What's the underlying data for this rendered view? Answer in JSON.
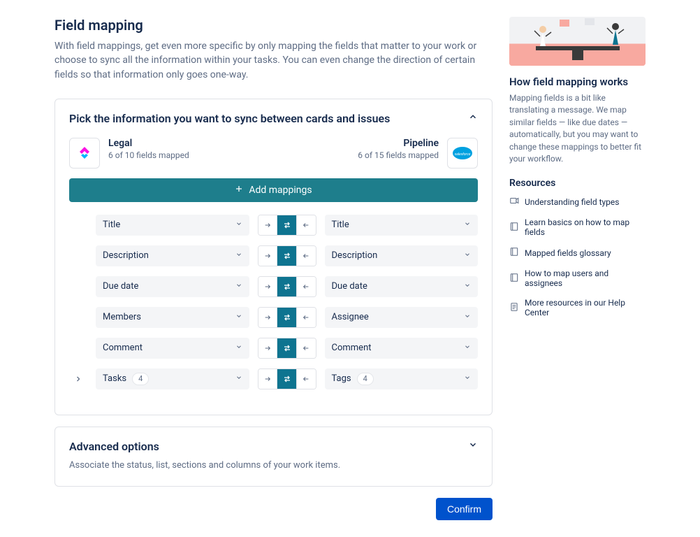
{
  "header": {
    "title": "Field mapping",
    "subtitle": "With field mappings, get even more specific by only mapping the fields that matter to your work or choose to sync all the information within your tasks. You can even change the direction of certain fields so that information only goes one-way."
  },
  "panel": {
    "title": "Pick the information you want to sync between cards and issues",
    "left_app": {
      "name": "Legal",
      "meta": "6 of 10 fields mapped"
    },
    "right_app": {
      "name": "Pipeline",
      "meta": "6 of 15 fields mapped"
    },
    "add_label": "Add mappings",
    "rows": [
      {
        "left": "Title",
        "right": "Title",
        "left_count": null,
        "right_count": null,
        "expandable": false
      },
      {
        "left": "Description",
        "right": "Description",
        "left_count": null,
        "right_count": null,
        "expandable": false
      },
      {
        "left": "Due date",
        "right": "Due date",
        "left_count": null,
        "right_count": null,
        "expandable": false
      },
      {
        "left": "Members",
        "right": "Assignee",
        "left_count": null,
        "right_count": null,
        "expandable": false
      },
      {
        "left": "Comment",
        "right": "Comment",
        "left_count": null,
        "right_count": null,
        "expandable": false
      },
      {
        "left": "Tasks",
        "right": "Tags",
        "left_count": "4",
        "right_count": "4",
        "expandable": true
      }
    ]
  },
  "advanced": {
    "title": "Advanced options",
    "desc": "Associate the status, list, sections and columns of your work items."
  },
  "confirm_label": "Confirm",
  "side": {
    "how_title": "How field mapping works",
    "how_body": "Mapping fields is a bit like translating a message. We map similar fields — like due dates — automatically, but you may want to change these mappings to better fit your workflow.",
    "resources_title": "Resources",
    "links": [
      "Understanding field types",
      "Learn basics on how to map fields",
      "Mapped fields glossary",
      "How to map users and assignees",
      "More resources in our Help Center"
    ]
  }
}
